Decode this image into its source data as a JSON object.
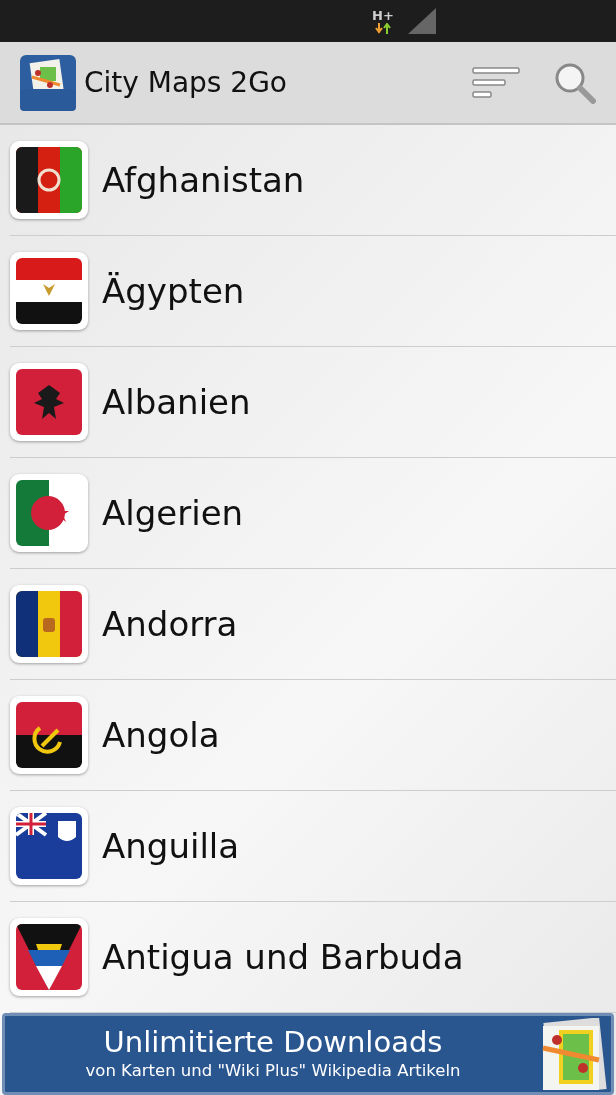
{
  "status_bar": {
    "network": "H+"
  },
  "app_bar": {
    "title": "City Maps 2Go"
  },
  "countries": [
    {
      "name": "Afghanistan",
      "kind": "afghanistan"
    },
    {
      "name": "Ägypten",
      "kind": "egypt"
    },
    {
      "name": "Albanien",
      "kind": "albania"
    },
    {
      "name": "Algerien",
      "kind": "algeria"
    },
    {
      "name": "Andorra",
      "kind": "andorra"
    },
    {
      "name": "Angola",
      "kind": "angola"
    },
    {
      "name": "Anguilla",
      "kind": "anguilla"
    },
    {
      "name": "Antigua und Barbuda",
      "kind": "antigua"
    }
  ],
  "banner": {
    "title": "Unlimitierte Downloads",
    "subtitle": "von Karten und \"Wiki Plus\" Wikipedia Artikeln"
  }
}
